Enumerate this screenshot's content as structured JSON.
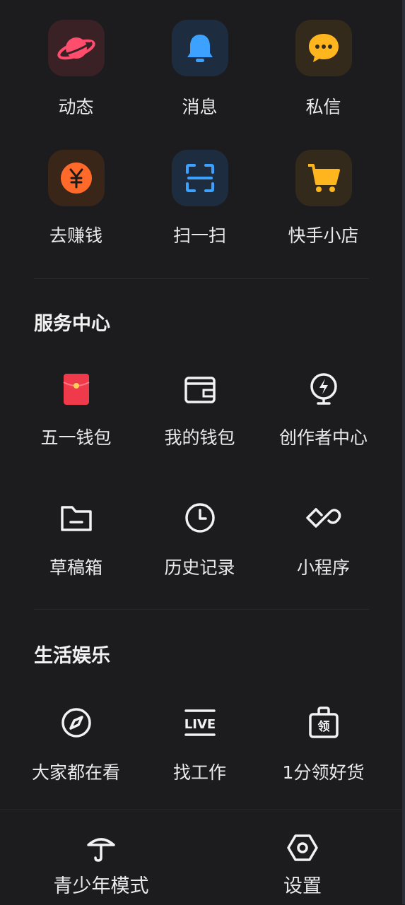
{
  "top_grid": {
    "row1": [
      {
        "label": "动态",
        "icon": "planet-icon",
        "color": "#ff4d6d"
      },
      {
        "label": "消息",
        "icon": "bell-icon",
        "color": "#3da2ff"
      },
      {
        "label": "私信",
        "icon": "chat-bubble-icon",
        "color": "#ffb61e"
      }
    ],
    "row2": [
      {
        "label": "去赚钱",
        "icon": "yuan-coin-icon",
        "color": "#ff6a2b"
      },
      {
        "label": "扫一扫",
        "icon": "scan-icon",
        "color": "#3da2ff"
      },
      {
        "label": "快手小店",
        "icon": "cart-icon",
        "color": "#ffb61e"
      }
    ]
  },
  "service_center": {
    "title": "服务中心",
    "row1": [
      {
        "label": "五一钱包",
        "icon": "red-envelope-icon"
      },
      {
        "label": "我的钱包",
        "icon": "wallet-icon"
      },
      {
        "label": "创作者中心",
        "icon": "lightning-bulb-icon"
      }
    ],
    "row2": [
      {
        "label": "草稿箱",
        "icon": "folder-icon"
      },
      {
        "label": "历史记录",
        "icon": "clock-icon"
      },
      {
        "label": "小程序",
        "icon": "mini-program-icon"
      }
    ]
  },
  "life_entertainment": {
    "title": "生活娱乐",
    "row1": [
      {
        "label": "大家都在看",
        "icon": "compass-icon"
      },
      {
        "label": "找工作",
        "icon": "live-icon",
        "icon_text": "LIVE"
      },
      {
        "label": "1分领好货",
        "icon": "bag-icon",
        "icon_text": "领"
      }
    ]
  },
  "bottom_bar": {
    "left": {
      "label": "青少年模式",
      "icon": "umbrella-icon"
    },
    "right": {
      "label": "设置",
      "icon": "settings-hexagon-icon"
    }
  }
}
